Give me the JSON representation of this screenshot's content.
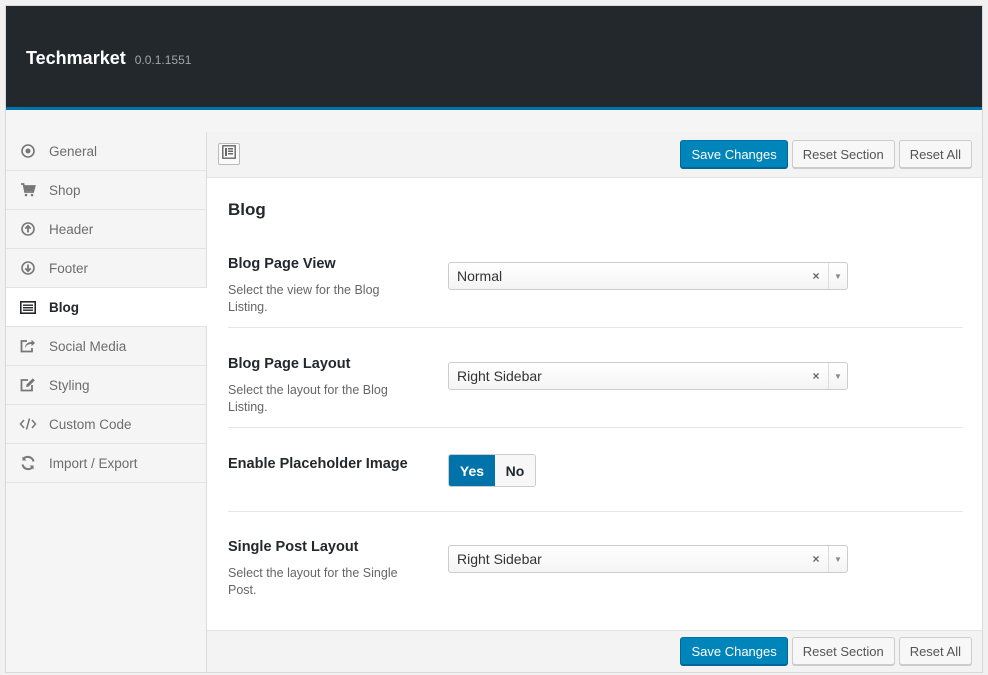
{
  "app": {
    "title": "Techmarket",
    "version": "0.0.1.1551"
  },
  "sidebar": {
    "items": [
      {
        "label": "General",
        "icon": "target-circle-icon",
        "active": false
      },
      {
        "label": "Shop",
        "icon": "cart-icon",
        "active": false
      },
      {
        "label": "Header",
        "icon": "arrow-up-circle-icon",
        "active": false
      },
      {
        "label": "Footer",
        "icon": "arrow-down-circle-icon",
        "active": false
      },
      {
        "label": "Blog",
        "icon": "list-icon",
        "active": true
      },
      {
        "label": "Social Media",
        "icon": "share-icon",
        "active": false
      },
      {
        "label": "Styling",
        "icon": "edit-icon",
        "active": false
      },
      {
        "label": "Custom Code",
        "icon": "code-icon",
        "active": false
      },
      {
        "label": "Import / Export",
        "icon": "refresh-icon",
        "active": false
      }
    ]
  },
  "toolbar": {
    "save_label": "Save Changes",
    "reset_section_label": "Reset Section",
    "reset_all_label": "Reset All"
  },
  "section": {
    "title": "Blog"
  },
  "fields": {
    "blog_page_view": {
      "label": "Blog Page View",
      "desc": "Select the view for the Blog Listing.",
      "value": "Normal"
    },
    "blog_page_layout": {
      "label": "Blog Page Layout",
      "desc": "Select the layout for the Blog Listing.",
      "value": "Right Sidebar"
    },
    "placeholder_image": {
      "label": "Enable Placeholder Image",
      "yes": "Yes",
      "no": "No",
      "selected": "Yes"
    },
    "single_post_layout": {
      "label": "Single Post Layout",
      "desc": "Select the layout for the Single Post.",
      "value": "Right Sidebar"
    }
  },
  "colors": {
    "accent": "#0073aa",
    "header_bg": "#23282d",
    "primary_button": "#0085ba"
  }
}
